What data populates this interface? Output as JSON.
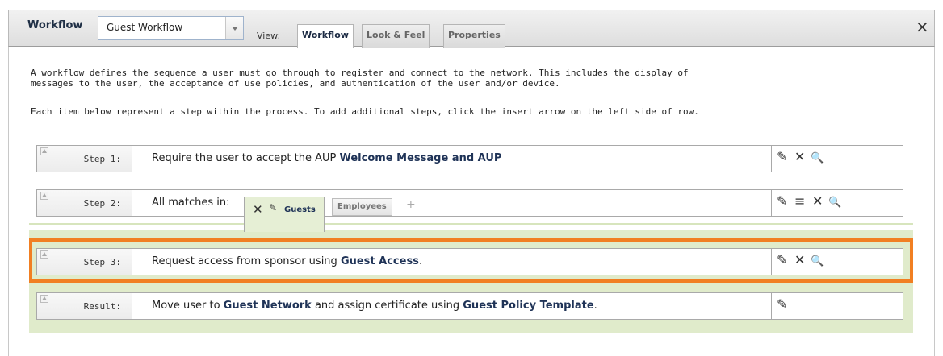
{
  "header": {
    "title": "Workflow",
    "workflow_select": "Guest Workflow",
    "view_label": "View:",
    "tabs": [
      {
        "label": "Workflow",
        "active": true
      },
      {
        "label": "Look & Feel",
        "active": false
      },
      {
        "label": "Properties",
        "active": false
      }
    ],
    "close_glyph": "×"
  },
  "description": {
    "line1": "A workflow defines the sequence a user must go through to register and connect to the network. This includes the display of",
    "line2": "messages to the user, the acceptance of use policies, and authentication of the user and/or device.",
    "line3": "Each item below represent a step within the process. To add additional steps, click the insert arrow on the left side of row."
  },
  "steps": [
    {
      "label": "Step 1:",
      "text": "Require the user to accept the AUP ",
      "link": "Welcome Message and AUP",
      "suffix": ""
    },
    {
      "label": "Step 2:",
      "text": "All matches in:",
      "match_tabs": [
        {
          "label": "Guests",
          "active": true
        },
        {
          "label": "Employees",
          "active": false
        }
      ],
      "add_glyph": "+"
    },
    {
      "label": "Step 3:",
      "text": "Request access from sponsor using ",
      "link": "Guest Access",
      "suffix": "."
    },
    {
      "label": "Result:",
      "text": "Move user to ",
      "link": "Guest Network",
      "mid": " and assign certificate using ",
      "link2": "Guest Policy Template",
      "suffix": "."
    }
  ],
  "icons": {
    "edit": "✎",
    "delete": "✕",
    "view": "🔍",
    "list": "≡"
  },
  "colors": {
    "highlight": "#f17f22",
    "group_bg": "#e0ebcb",
    "link": "#1f3357"
  }
}
